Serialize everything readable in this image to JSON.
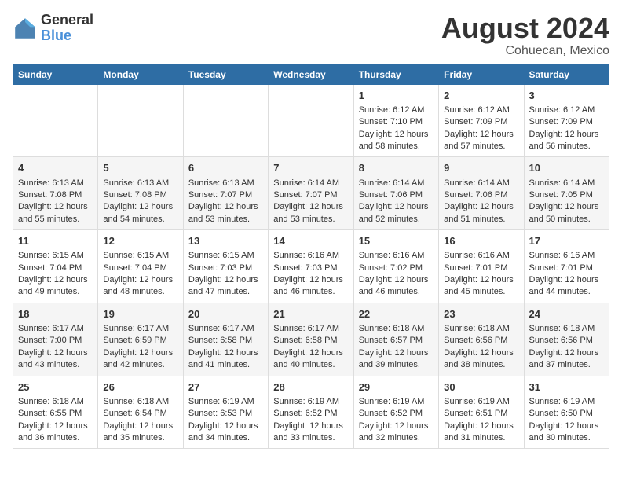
{
  "header": {
    "logo_line1": "General",
    "logo_line2": "Blue",
    "title": "August 2024",
    "subtitle": "Cohuecan, Mexico"
  },
  "days_of_week": [
    "Sunday",
    "Monday",
    "Tuesday",
    "Wednesday",
    "Thursday",
    "Friday",
    "Saturday"
  ],
  "weeks": [
    [
      {
        "day": "",
        "info": ""
      },
      {
        "day": "",
        "info": ""
      },
      {
        "day": "",
        "info": ""
      },
      {
        "day": "",
        "info": ""
      },
      {
        "day": "1",
        "info": "Sunrise: 6:12 AM\nSunset: 7:10 PM\nDaylight: 12 hours\nand 58 minutes."
      },
      {
        "day": "2",
        "info": "Sunrise: 6:12 AM\nSunset: 7:09 PM\nDaylight: 12 hours\nand 57 minutes."
      },
      {
        "day": "3",
        "info": "Sunrise: 6:12 AM\nSunset: 7:09 PM\nDaylight: 12 hours\nand 56 minutes."
      }
    ],
    [
      {
        "day": "4",
        "info": "Sunrise: 6:13 AM\nSunset: 7:08 PM\nDaylight: 12 hours\nand 55 minutes."
      },
      {
        "day": "5",
        "info": "Sunrise: 6:13 AM\nSunset: 7:08 PM\nDaylight: 12 hours\nand 54 minutes."
      },
      {
        "day": "6",
        "info": "Sunrise: 6:13 AM\nSunset: 7:07 PM\nDaylight: 12 hours\nand 53 minutes."
      },
      {
        "day": "7",
        "info": "Sunrise: 6:14 AM\nSunset: 7:07 PM\nDaylight: 12 hours\nand 53 minutes."
      },
      {
        "day": "8",
        "info": "Sunrise: 6:14 AM\nSunset: 7:06 PM\nDaylight: 12 hours\nand 52 minutes."
      },
      {
        "day": "9",
        "info": "Sunrise: 6:14 AM\nSunset: 7:06 PM\nDaylight: 12 hours\nand 51 minutes."
      },
      {
        "day": "10",
        "info": "Sunrise: 6:14 AM\nSunset: 7:05 PM\nDaylight: 12 hours\nand 50 minutes."
      }
    ],
    [
      {
        "day": "11",
        "info": "Sunrise: 6:15 AM\nSunset: 7:04 PM\nDaylight: 12 hours\nand 49 minutes."
      },
      {
        "day": "12",
        "info": "Sunrise: 6:15 AM\nSunset: 7:04 PM\nDaylight: 12 hours\nand 48 minutes."
      },
      {
        "day": "13",
        "info": "Sunrise: 6:15 AM\nSunset: 7:03 PM\nDaylight: 12 hours\nand 47 minutes."
      },
      {
        "day": "14",
        "info": "Sunrise: 6:16 AM\nSunset: 7:03 PM\nDaylight: 12 hours\nand 46 minutes."
      },
      {
        "day": "15",
        "info": "Sunrise: 6:16 AM\nSunset: 7:02 PM\nDaylight: 12 hours\nand 46 minutes."
      },
      {
        "day": "16",
        "info": "Sunrise: 6:16 AM\nSunset: 7:01 PM\nDaylight: 12 hours\nand 45 minutes."
      },
      {
        "day": "17",
        "info": "Sunrise: 6:16 AM\nSunset: 7:01 PM\nDaylight: 12 hours\nand 44 minutes."
      }
    ],
    [
      {
        "day": "18",
        "info": "Sunrise: 6:17 AM\nSunset: 7:00 PM\nDaylight: 12 hours\nand 43 minutes."
      },
      {
        "day": "19",
        "info": "Sunrise: 6:17 AM\nSunset: 6:59 PM\nDaylight: 12 hours\nand 42 minutes."
      },
      {
        "day": "20",
        "info": "Sunrise: 6:17 AM\nSunset: 6:58 PM\nDaylight: 12 hours\nand 41 minutes."
      },
      {
        "day": "21",
        "info": "Sunrise: 6:17 AM\nSunset: 6:58 PM\nDaylight: 12 hours\nand 40 minutes."
      },
      {
        "day": "22",
        "info": "Sunrise: 6:18 AM\nSunset: 6:57 PM\nDaylight: 12 hours\nand 39 minutes."
      },
      {
        "day": "23",
        "info": "Sunrise: 6:18 AM\nSunset: 6:56 PM\nDaylight: 12 hours\nand 38 minutes."
      },
      {
        "day": "24",
        "info": "Sunrise: 6:18 AM\nSunset: 6:56 PM\nDaylight: 12 hours\nand 37 minutes."
      }
    ],
    [
      {
        "day": "25",
        "info": "Sunrise: 6:18 AM\nSunset: 6:55 PM\nDaylight: 12 hours\nand 36 minutes."
      },
      {
        "day": "26",
        "info": "Sunrise: 6:18 AM\nSunset: 6:54 PM\nDaylight: 12 hours\nand 35 minutes."
      },
      {
        "day": "27",
        "info": "Sunrise: 6:19 AM\nSunset: 6:53 PM\nDaylight: 12 hours\nand 34 minutes."
      },
      {
        "day": "28",
        "info": "Sunrise: 6:19 AM\nSunset: 6:52 PM\nDaylight: 12 hours\nand 33 minutes."
      },
      {
        "day": "29",
        "info": "Sunrise: 6:19 AM\nSunset: 6:52 PM\nDaylight: 12 hours\nand 32 minutes."
      },
      {
        "day": "30",
        "info": "Sunrise: 6:19 AM\nSunset: 6:51 PM\nDaylight: 12 hours\nand 31 minutes."
      },
      {
        "day": "31",
        "info": "Sunrise: 6:19 AM\nSunset: 6:50 PM\nDaylight: 12 hours\nand 30 minutes."
      }
    ]
  ]
}
